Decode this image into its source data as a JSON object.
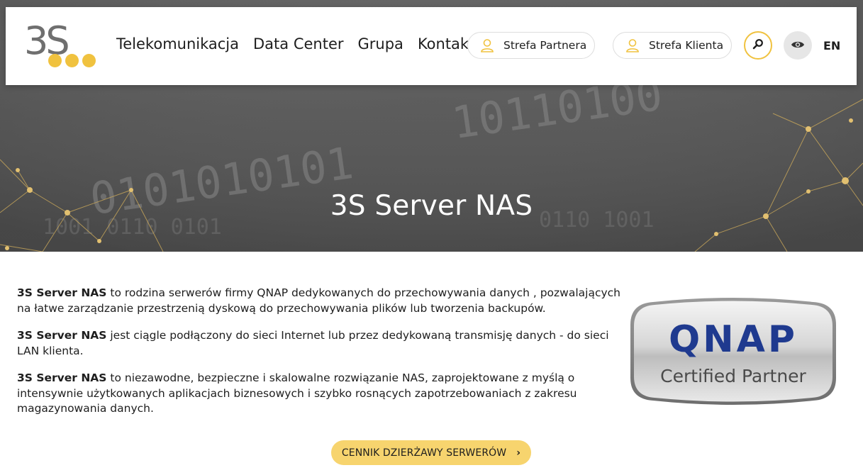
{
  "header": {
    "logo": {
      "text": "3S",
      "dot_color": "#f0c23f"
    },
    "nav": [
      {
        "label": "Telekomunikacja"
      },
      {
        "label": "Data Center"
      },
      {
        "label": "Grupa"
      },
      {
        "label": "Kontakt"
      }
    ],
    "partner_zone": {
      "label": "Strefa Partnera",
      "icon": "user-icon"
    },
    "client_zone": {
      "label": "Strefa Klienta",
      "icon": "user-icon"
    },
    "search": {
      "icon": "search-icon"
    },
    "accessibility": {
      "icon": "eye-icon"
    },
    "language": "EN"
  },
  "hero": {
    "title": "3S Server NAS"
  },
  "content": {
    "paragraphs": [
      {
        "bold": "3S Server NAS",
        "text": " to rodzina serwerów firmy QNAP dedykowanych do przechowywania danych , pozwalających na łatwe zarządzanie przestrzenią dyskową do przechowywania plików lub tworzenia backupów."
      },
      {
        "bold": "3S Server NAS",
        "text": " jest ciągle podłączony do sieci Internet lub przez dedykowaną transmisję danych - do sieci LAN klienta."
      },
      {
        "bold": "3S Server NAS",
        "text": " to niezawodne, bezpieczne i skalowalne rozwiązanie NAS, zaprojektowane z myślą o intensywnie użytkowanych aplikacjach biznesowych i szybko rosnących zapotrzebowaniach z zakresu magazynowania danych."
      }
    ]
  },
  "badge": {
    "brand": "QNAP",
    "subtitle": "Certified Partner"
  },
  "cta": {
    "label": "CENNIK DZIERŻAWY SERWERÓW",
    "chevron": "›"
  },
  "colors": {
    "accent": "#f0c23f",
    "cta_bg": "#f7d46e",
    "qnap_blue": "#1f3a8f"
  }
}
